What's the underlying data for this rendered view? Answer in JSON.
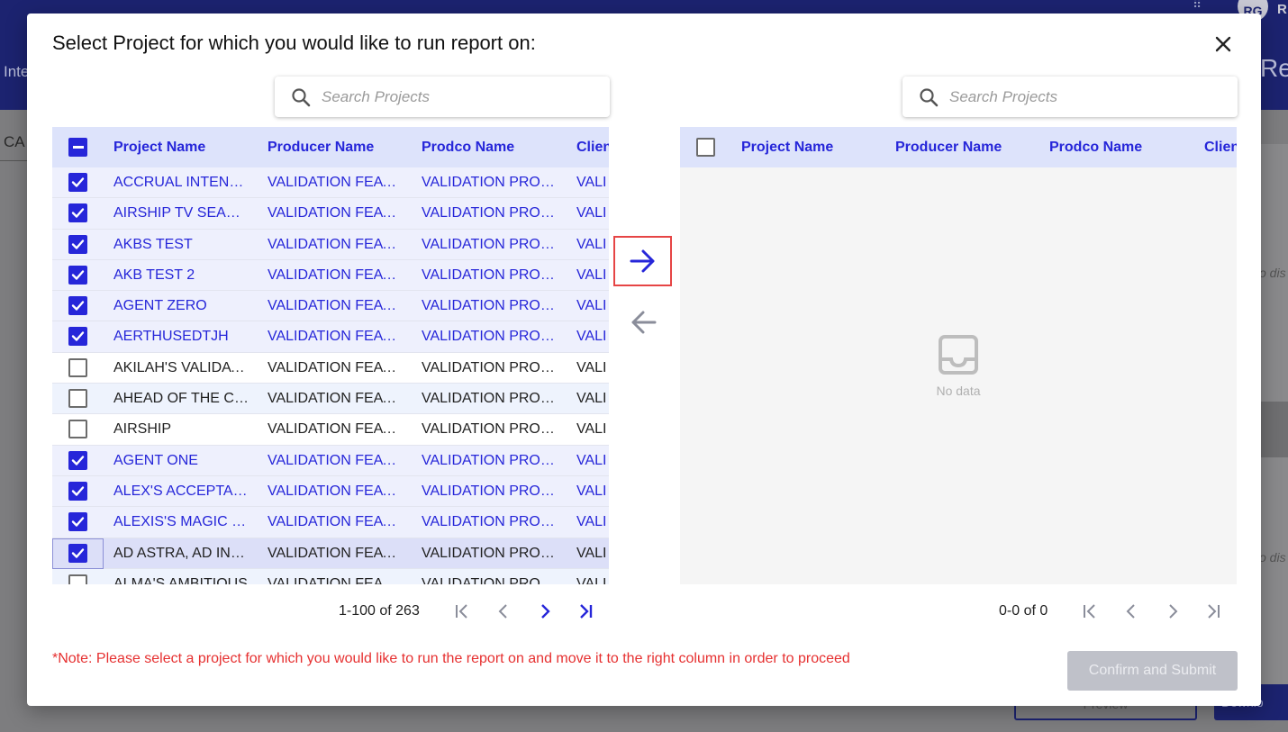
{
  "background": {
    "avatar_initials": "RG",
    "avatar_tail": "R",
    "left_partial": "Inte",
    "right_partial": "Re",
    "tab_partial": "CA",
    "italic_partial_1": "o dis",
    "italic_partial_2": "o dis",
    "preview_partial": "Preview",
    "download_partial": "Downlo"
  },
  "modal": {
    "title": "Select Project for which you would like to run report on:",
    "close_icon": "close-icon",
    "note": "*Note: Please select a project for which you would like to run the report on and move it to the right column in order to proceed",
    "confirm_label": "Confirm and Submit"
  },
  "left": {
    "search_placeholder": "Search Projects",
    "columns": [
      "Project Name",
      "Producer Name",
      "Prodco Name",
      "Clien"
    ],
    "header_checkbox": "indeterminate",
    "rows": [
      {
        "project": "ACCRUAL INTENTIONALLY",
        "producer": "VALIDATION FEATURES",
        "prodco": "VALIDATION PRODCO",
        "client": "VALI",
        "checked": true
      },
      {
        "project": "AIRSHIP TV SEASON",
        "producer": "VALIDATION FEATURES",
        "prodco": "VALIDATION PRODCO",
        "client": "VALI",
        "checked": true
      },
      {
        "project": "AKBS TEST",
        "producer": "VALIDATION FEATURES",
        "prodco": "VALIDATION PRODCO",
        "client": "VALI",
        "checked": true
      },
      {
        "project": "AKB TEST 2",
        "producer": "VALIDATION FEATURES",
        "prodco": "VALIDATION PRODCO",
        "client": "VALI",
        "checked": true
      },
      {
        "project": "AGENT ZERO",
        "producer": "VALIDATION FEATURES",
        "prodco": "VALIDATION PRODCO",
        "client": "VALI",
        "checked": true
      },
      {
        "project": "AERTHUSEDTJH",
        "producer": "VALIDATION FEATURES",
        "prodco": "VALIDATION PRODCO",
        "client": "VALI",
        "checked": true
      },
      {
        "project": "AKILAH'S VALIDATION",
        "producer": "VALIDATION FEATURES",
        "prodco": "VALIDATION PRODCO",
        "client": "VALI",
        "checked": false
      },
      {
        "project": "AHEAD OF THE CURVE",
        "producer": "VALIDATION FEATURES",
        "prodco": "VALIDATION PRODCO",
        "client": "VALI",
        "checked": false
      },
      {
        "project": "AIRSHIP",
        "producer": "VALIDATION FEATURES",
        "prodco": "VALIDATION PRODCO",
        "client": "VALI",
        "checked": false
      },
      {
        "project": "AGENT ONE",
        "producer": "VALIDATION FEATURES",
        "prodco": "VALIDATION PRODCO",
        "client": "VALI",
        "checked": true
      },
      {
        "project": "ALEX'S ACCEPTABLE",
        "producer": "VALIDATION FEATURES",
        "prodco": "VALIDATION PRODCO",
        "client": "VALI",
        "checked": true
      },
      {
        "project": "ALEXIS'S MAGIC DAY",
        "producer": "VALIDATION FEATURES",
        "prodco": "VALIDATION PRODCO",
        "client": "VALI",
        "checked": true
      },
      {
        "project": "AD ASTRA, AD INFINITUM",
        "producer": "VALIDATION FEATURES",
        "prodco": "VALIDATION PRODCO",
        "client": "VALI",
        "checked": true
      },
      {
        "project": "ALMA'S AMBITIOUS",
        "producer": "VALIDATION FEATURES",
        "prodco": "VALIDATION PRODCO",
        "client": "VALI",
        "checked": false
      }
    ],
    "pagination_text": "1-100 of 263"
  },
  "right": {
    "search_placeholder": "Search Projects",
    "columns": [
      "Project Name",
      "Producer Name",
      "Prodco Name",
      "Clien"
    ],
    "empty_text": "No data",
    "pagination_text": "0-0 of 0"
  },
  "colors": {
    "accent": "#2626d9",
    "header_bg": "#dde3fb",
    "note_red": "#e63030",
    "highlight_red": "#e64545"
  }
}
